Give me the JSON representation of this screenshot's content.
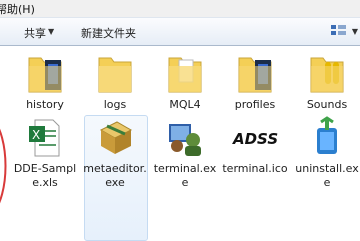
{
  "menubar": {
    "help_label": "帮助(H)"
  },
  "toolbar": {
    "share_label": "共享",
    "new_folder_label": "新建文件夹"
  },
  "files": {
    "history": "history",
    "logs": "logs",
    "mql4": "MQL4",
    "profiles": "profiles",
    "sounds": "Sounds",
    "dde_sample": "DDE-Sample.xls",
    "metaeditor": "metaeditor.exe",
    "terminal_exe": "terminal.exe",
    "terminal_ico": "terminal.ico",
    "uninstall": "uninstall.exe"
  },
  "terminal_ico_text": "ADSS",
  "colors": {
    "folder": "#f4cf56",
    "selection": "#e6f0fb",
    "accent_red": "#d83a3a"
  }
}
